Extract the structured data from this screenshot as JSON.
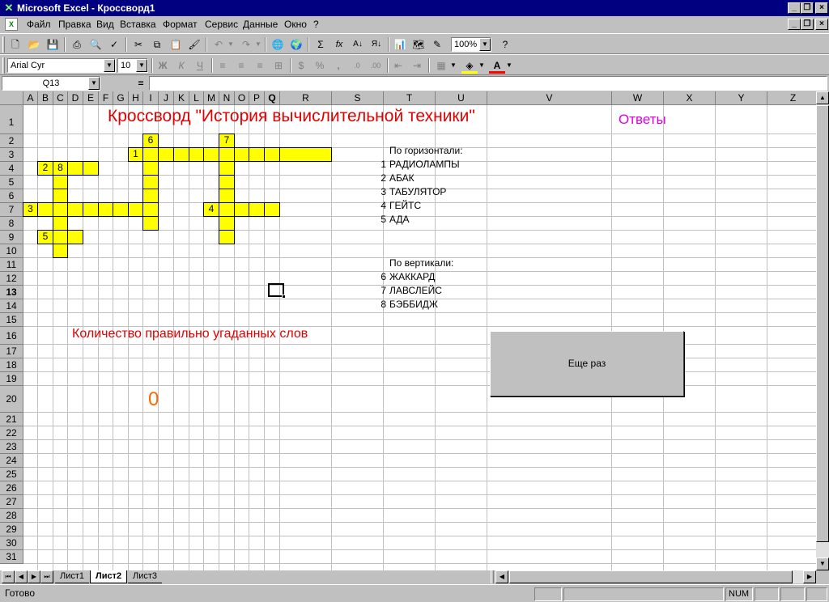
{
  "window": {
    "title": "Microsoft Excel - Кроссворд1"
  },
  "menu": [
    "Файл",
    "Правка",
    "Вид",
    "Вставка",
    "Формат",
    "Сервис",
    "Данные",
    "Окно",
    "?"
  ],
  "toolbar": {
    "zoom": "100%",
    "font_name": "Arial Cyr",
    "font_size": "10",
    "bold": "Ж",
    "italic": "К",
    "underline": "Ч",
    "autosum": "Σ",
    "function": "fx",
    "percent": "%",
    "comma": ","
  },
  "formula_bar": {
    "name_box": "Q13",
    "equals": "=",
    "content": ""
  },
  "columns": [
    "A",
    "B",
    "C",
    "D",
    "E",
    "F",
    "G",
    "H",
    "I",
    "J",
    "K",
    "L",
    "M",
    "N",
    "O",
    "P",
    "Q",
    "R",
    "S",
    "T",
    "U",
    "V",
    "W",
    "X",
    "Y",
    "Z"
  ],
  "rows": [
    "1",
    "2",
    "3",
    "4",
    "5",
    "6",
    "7",
    "8",
    "9",
    "10",
    "11",
    "12",
    "13",
    "14",
    "15",
    "16",
    "17",
    "18",
    "19",
    "20",
    "21",
    "22",
    "23",
    "24",
    "25",
    "26",
    "27",
    "28",
    "29",
    "30",
    "31"
  ],
  "selected": {
    "column": "Q",
    "row": "13"
  },
  "sheet": {
    "title": "Кроссворд \"История вычислительной техники\"",
    "answers_label": "Ответы",
    "across_header": "По горизонтали:",
    "across": [
      {
        "num": "1",
        "word": "РАДИОЛАМПЫ"
      },
      {
        "num": "2",
        "word": "АБАК"
      },
      {
        "num": "3",
        "word": "ТАБУЛЯТОР"
      },
      {
        "num": "4",
        "word": "ГЕЙТС"
      },
      {
        "num": "5",
        "word": "АДА"
      }
    ],
    "down_header": "По вертикали:",
    "down": [
      {
        "num": "6",
        "word": "ЖАККАРД"
      },
      {
        "num": "7",
        "word": "ЛАВСЛЕЙС"
      },
      {
        "num": "8",
        "word": "БЭББИДЖ"
      }
    ],
    "count_label": "Количество правильно угаданных слов",
    "count_value": "0",
    "button_label": "Еще раз",
    "crossword_numbers": [
      "6",
      "7",
      "1",
      "2",
      "8",
      "3",
      "4",
      "5"
    ]
  },
  "tabs": [
    "Лист1",
    "Лист2",
    "Лист3"
  ],
  "active_tab": "Лист2",
  "status": {
    "ready": "Готово",
    "num": "NUM"
  },
  "colors": {
    "title_red": "#e00000",
    "answers_magenta": "#e000e0",
    "count_orange": "#ff6600",
    "cell_yellow": "#ffff00",
    "titlebar_navy": "#000080"
  }
}
